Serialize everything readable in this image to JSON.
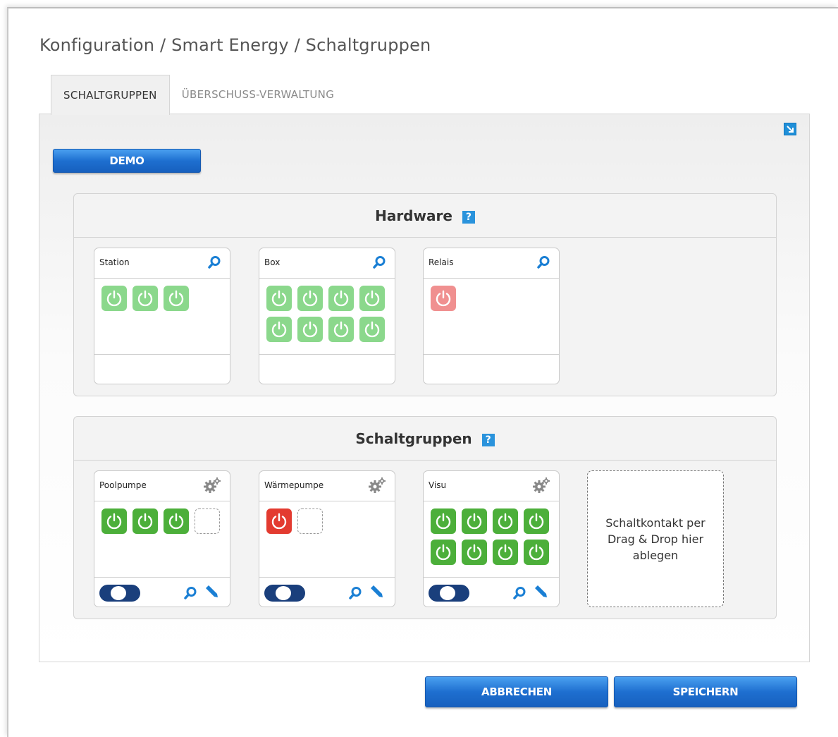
{
  "breadcrumb": "Konfiguration / Smart Energy / Schaltgruppen",
  "tabs": [
    {
      "label": "SCHALTGRUPPEN",
      "active": true
    },
    {
      "label": "ÜBERSCHUSS-VERWALTUNG",
      "active": false
    }
  ],
  "demo_label": "DEMO",
  "hardware": {
    "title": "Hardware",
    "help": "?",
    "cards": [
      {
        "name": "Station",
        "switches": [
          "green",
          "green",
          "green"
        ]
      },
      {
        "name": "Box",
        "switches": [
          "green",
          "green",
          "green",
          "green",
          "green",
          "green",
          "green",
          "green"
        ]
      },
      {
        "name": "Relais",
        "switches": [
          "red"
        ]
      }
    ]
  },
  "groups": {
    "title": "Schaltgruppen",
    "help": "?",
    "cards": [
      {
        "name": "Poolpumpe",
        "switches": [
          "green",
          "green",
          "green",
          "empty"
        ]
      },
      {
        "name": "Wärmepumpe",
        "switches": [
          "red",
          "empty"
        ]
      },
      {
        "name": "Visu",
        "switches": [
          "green",
          "green",
          "green",
          "green",
          "green",
          "green",
          "green",
          "green"
        ]
      }
    ],
    "dropzone_text": "Schaltkontakt per Drag & Drop hier ablegen"
  },
  "buttons": {
    "cancel": "ABBRECHEN",
    "save": "SPEICHERN"
  },
  "colors": {
    "accent": "#1e6fd0",
    "hw_on": "#8bd88c",
    "hw_off": "#f09090",
    "group_on": "#4caf3a",
    "group_off": "#e33b30",
    "toggle": "#1a3f7c"
  }
}
